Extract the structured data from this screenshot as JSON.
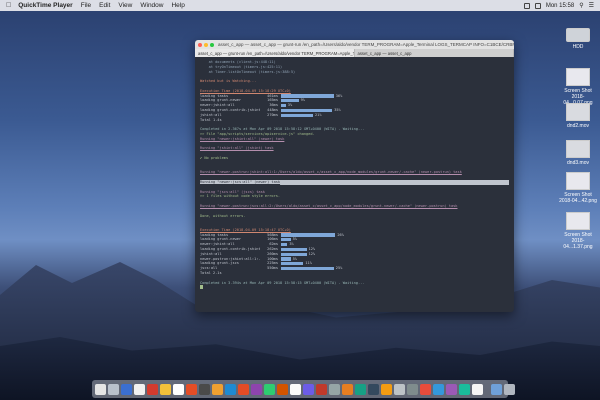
{
  "menubar": {
    "app_name": "QuickTime Player",
    "menus": [
      "File",
      "Edit",
      "View",
      "Window",
      "Help"
    ],
    "clock": "Mon 15:58"
  },
  "desktop_icons": [
    {
      "label": "HDD",
      "kind": "hdd"
    },
    {
      "label": "Screen Shot 2018-04...0.07.png",
      "kind": "img"
    },
    {
      "label": "dnd2.mov",
      "kind": "vid"
    },
    {
      "label": "dnd3.mov",
      "kind": "vid"
    },
    {
      "label": "Screen Shot 2018-04...42.png",
      "kind": "img"
    },
    {
      "label": "Screen Shot 2018-04...1.37.png",
      "kind": "img"
    }
  ],
  "window": {
    "title": "asset_c_app — asset_c_app — grunt-run /en_path=/Users/aldo/vendor TERM_PROGRAM=Apple_Terminal LOGS_TERMCAP INFO=C1BCE/CRBF/~: 140x44",
    "tabs": [
      "asset_c_app — grunt-run /en_path=/Users/aldo/vendor TERM_PROGRAM=Apple_Te...",
      "asset_c_app — asset_c_app"
    ]
  },
  "terminal": {
    "pre_lines": [
      {
        "text": "    at documents (client.js:448:11)",
        "cls": "c-blue"
      },
      {
        "text": "    at tryOnTimeout (timers.js:425:11)",
        "cls": "c-blue"
      },
      {
        "text": "    at Timer.listOnTimeout (timers.js:388:5)",
        "cls": "c-blue"
      },
      {
        "text": "",
        "cls": ""
      },
      {
        "text": "Watched but is Watching...",
        "cls": "c-orange"
      },
      {
        "text": "",
        "cls": ""
      },
      {
        "text": "Execution Time (2018-04-09 15:18:29 UTC+0)",
        "cls": "c-orange u"
      }
    ],
    "timing1": [
      {
        "label": "loading tasks",
        "time": "461ms",
        "fill": 0.33,
        "pct": "36%"
      },
      {
        "label": "loading grunt-newer",
        "time": "165ms",
        "fill": 0.11,
        "pct": "9%"
      },
      {
        "label": "newer:jshint:all",
        "time": "36ms",
        "fill": 0.03,
        "pct": "3%"
      },
      {
        "label": "loading grunt-contrib-jshint",
        "time": "448ms",
        "fill": 0.32,
        "pct": "35%"
      },
      {
        "label": "jshint:all",
        "time": "270ms",
        "fill": 0.2,
        "pct": "21%"
      }
    ],
    "total1": "Total 1.4s",
    "mid_lines": [
      {
        "text": "",
        "cls": ""
      },
      {
        "text": "Completed in 2.367s at Mon Apr 09 2018 15:58:12 GMT+0400 (WITA) - Waiting...",
        "cls": "c-teal"
      },
      {
        "text": ">> File \"app/scripts/services/apiservice.js\" changed.",
        "cls": "c-green"
      },
      {
        "text": "Running \"newer:jshint:all\" (newer) task",
        "cls": "c-pink u"
      },
      {
        "text": "",
        "cls": ""
      },
      {
        "text": "Running \"jshint:all\" (jshint) task",
        "cls": "c-pink u"
      },
      {
        "text": "",
        "cls": ""
      },
      {
        "text": "✔ No problems",
        "cls": "c-green"
      },
      {
        "text": "",
        "cls": ""
      },
      {
        "text": "",
        "cls": ""
      },
      {
        "text": "Running \"newer-postrun:jshint:all:1:/Users/aldo/asset_c/asset_c_app/node_modules/grunt-newer/.cache\" (newer-postrun) task",
        "cls": "c-pink u"
      },
      {
        "text": "",
        "cls": ""
      },
      {
        "text": "Running \"newer:jscs:all\" (newer) task",
        "cls": "c-pink u highlight"
      },
      {
        "text": "",
        "cls": ""
      },
      {
        "text": "Running \"jscs:all\" (jscs) task",
        "cls": "c-pink u"
      },
      {
        "text": ">> 1 files without code style errors.",
        "cls": "c-green"
      },
      {
        "text": "",
        "cls": ""
      },
      {
        "text": "Running \"newer-postrun:jscs:all:2:/Users/aldo/asset_c/asset_c_app/node_modules/grunt-newer/.cache\" (newer-postrun) task",
        "cls": "c-pink u"
      },
      {
        "text": "",
        "cls": ""
      },
      {
        "text": "Done, without errors.",
        "cls": "c-green"
      },
      {
        "text": "",
        "cls": ""
      },
      {
        "text": "",
        "cls": ""
      },
      {
        "text": "Execution Time (2018-04-09 15:18:47 UTC+0)",
        "cls": "c-orange u"
      }
    ],
    "timing2": [
      {
        "label": "loading tasks",
        "time": "568ms",
        "fill": 0.34,
        "pct": "26%"
      },
      {
        "label": "loading grunt-newer",
        "time": "106ms",
        "fill": 0.06,
        "pct": "5%"
      },
      {
        "label": "newer:jshint:all",
        "time": "62ms",
        "fill": 0.04,
        "pct": "3%"
      },
      {
        "label": "loading grunt-contrib-jshint",
        "time": "262ms",
        "fill": 0.16,
        "pct": "12%"
      },
      {
        "label": "jshint:all",
        "time": "260ms",
        "fill": 0.16,
        "pct": "12%"
      },
      {
        "label": "newer-postrun:jshint:all:1:...de_modules/grunt-newer/.cache",
        "time": "100ms",
        "fill": 0.06,
        "pct": "5%"
      },
      {
        "label": "loading grunt-jscs",
        "time": "225ms",
        "fill": 0.14,
        "pct": "11%"
      },
      {
        "label": "jscs:all",
        "time": "550ms",
        "fill": 0.33,
        "pct": "25%"
      }
    ],
    "total2": "Total 2.1s",
    "completed2": "Completed in 3.394s at Mon Apr 09 2018 15:58:15 GMT+0400 (WITA) - Waiting..."
  },
  "dock": {
    "colors": [
      "#e5e5e5",
      "#b9c1cc",
      "#3b6fd1",
      "#f1f1f1",
      "#d33b2f",
      "#f4c13a",
      "#ffffff",
      "#e44d26",
      "#4a4a4a",
      "#f0a030",
      "#1f8ad1",
      "#e34c26",
      "#8e44ad",
      "#2ecc71",
      "#d35400",
      "#fafafa",
      "#6c5ce7",
      "#c0392b",
      "#95a5a6",
      "#e67e22",
      "#16a085",
      "#34495e",
      "#f39c12",
      "#bdc3c7",
      "#7f8c8d",
      "#e74c3c",
      "#3498db",
      "#9b59b6",
      "#1abc9c",
      "#f5f5f5"
    ],
    "trail_colors": [
      "#6fa0d8",
      "#b0b6bf"
    ]
  }
}
